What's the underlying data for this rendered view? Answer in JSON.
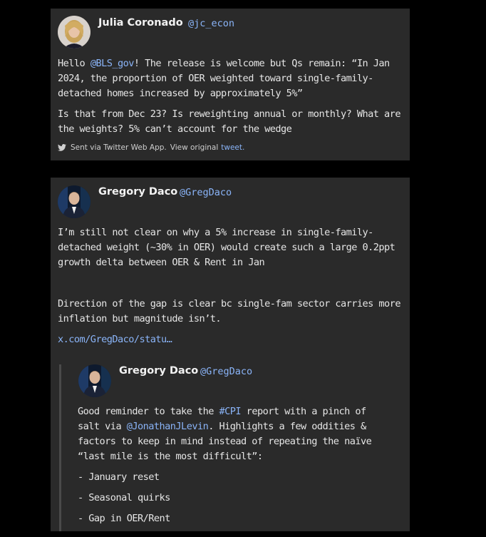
{
  "tweet1": {
    "name": "Julia Coronado",
    "handle": "@jc_econ",
    "para1_prefix": "Hello ",
    "para1_mention": "@BLS_gov",
    "para1_suffix": "! The release is welcome but Qs remain: “In Jan 2024, the proportion of OER weighted toward single-family-detached homes increased by approximately 5%”",
    "para2": "Is that from Dec 23? Is reweighting annual or monthly? What are the weights? 5% can’t account for the wedge",
    "footer_text": "Sent via Twitter Web App.",
    "footer_view": "View original",
    "footer_link": "tweet."
  },
  "tweet2": {
    "name": "Gregory Daco",
    "handle": "@GregDaco",
    "para1": "I’m still not clear on why a 5% increase in single-family-detached weight (~30% in OER) would create such a large 0.2ppt growth delta between OER & Rent in Jan",
    "para2": "Direction of the gap is clear bc single-fam sector carries more inflation but magnitude isn’t.",
    "url": "x.com/GregDaco/statu…"
  },
  "quoted": {
    "name": "Gregory Daco",
    "handle": "@GregDaco",
    "line_a": "Good reminder to take the ",
    "hashtag": "#CPI",
    "line_b": " report with a pinch of salt via ",
    "mention": "@JonathanJLevin",
    "line_c": ". Highlights a few oddities & factors to keep in mind instead of repeating the naïve “last mile is the most difficult”:",
    "bullets": [
      "- January reset",
      "- Seasonal quirks",
      "- Gap in OER/Rent"
    ]
  },
  "icons": {
    "footer": "twitter-bird-icon"
  },
  "colors": {
    "background": "#000000",
    "card": "#2a2a2a",
    "link": "#8ab4f8",
    "text": "#e6e6e6"
  }
}
